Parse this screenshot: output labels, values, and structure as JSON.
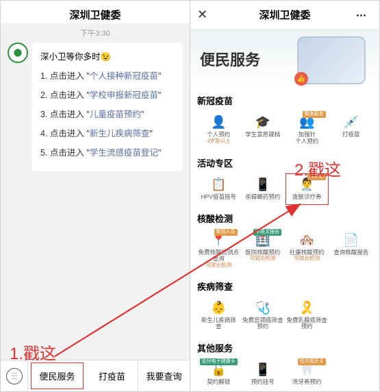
{
  "left": {
    "header_title": "深圳卫健委",
    "time": "下午3:30",
    "greeting": "深小卫等你多时",
    "greeting_emoji": "😉",
    "links_prefix": "点击进入",
    "links": [
      "个人接种新冠疫苗",
      "学校申报新冠疫苗",
      "儿童疫苗预约",
      "新生儿疾病筛查",
      "学生流感疫苗登记"
    ],
    "menu": [
      "便民服务",
      "打疫苗",
      "我要查询"
    ]
  },
  "right": {
    "header_title": "深圳卫健委",
    "hero_title": "便民服务",
    "sections": [
      {
        "title": "新冠疫苗",
        "items": [
          {
            "icon": "👤",
            "label": "个人预约",
            "sub": "3岁及以上",
            "color": "#e07a3a"
          },
          {
            "icon": "🎓",
            "label": "学生意愿建档",
            "color": "#3a8fbf"
          },
          {
            "icon": "👥",
            "label": "加强针\n个人预约",
            "badge": "集体报名",
            "badge_cls": "badge-o",
            "color": "#3a9b78"
          },
          {
            "icon": "💉",
            "label": "打疫苗",
            "color": "#e07a3a"
          }
        ]
      },
      {
        "title": "活动专区",
        "items": [
          {
            "icon": "📋",
            "label": "HPV疫苗摇号",
            "color": "#e07a3a"
          },
          {
            "icon": "📱",
            "label": "杀蟑螂药预约",
            "color": "#3a8fbf"
          },
          {
            "icon": "👨‍⚕️",
            "label": "皮肤诊疗券",
            "badge": "可申领",
            "badge_cls": "badge-o",
            "highlight": true,
            "color": "#3a9b78"
          },
          {
            "empty": true
          }
        ]
      },
      {
        "title": "核酸检测",
        "items": [
          {
            "icon": "📍",
            "label": "免费核酸检测点\n查询",
            "sub": "可就近检测",
            "badge": "新冠人员",
            "badge_cls": "badge-o",
            "color": "#3a8fbf"
          },
          {
            "icon": "🏥",
            "label": "医院核酸预约",
            "sub": "可就近检测",
            "badge": "中英文报告",
            "badge_cls": "badge-g",
            "color": "#3a9b78"
          },
          {
            "icon": "🏘️",
            "label": "社康核酸预约",
            "sub": "可就近检测",
            "color": "#e07a3a"
          },
          {
            "icon": "📄",
            "label": "查询核酸报告",
            "color": "#3a8fbf"
          }
        ]
      },
      {
        "title": "疾病筛查",
        "items": [
          {
            "icon": "👶",
            "label": "新生儿疾病筛\n查",
            "color": "#e07a3a"
          },
          {
            "icon": "🩺",
            "label": "免费宫颈癌筛查\n预约",
            "color": "#3a8fbf"
          },
          {
            "icon": "🎗️",
            "label": "免费乳腺癌筛查\n预约",
            "color": "#e07a8f"
          },
          {
            "empty": true
          }
        ]
      },
      {
        "title": "其他服务",
        "items": [
          {
            "icon": "🔓",
            "label": "契约解锁",
            "badge": "支付电子健康卡",
            "badge_cls": "badge-g",
            "color": "#3a9b78"
          },
          {
            "icon": "📱",
            "label": "预约挂号",
            "color": "#3a8fbf"
          },
          {
            "icon": "🦷",
            "label": "洗牙券预约",
            "badge": "社中洗牙卡",
            "badge_cls": "badge-o",
            "color": "#3a8fbf"
          },
          {
            "empty": true
          }
        ]
      }
    ]
  },
  "anno": {
    "step1": "1.戳这",
    "step2": "2.戳这"
  }
}
